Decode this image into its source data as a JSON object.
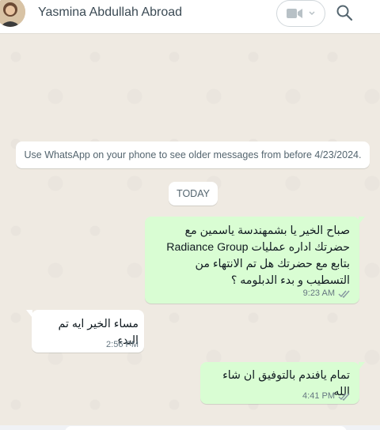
{
  "header": {
    "contact_name": "Yasmina Abdullah Abroad",
    "video_icon": "video-camera-icon",
    "dropdown_icon": "chevron-down-icon",
    "search_icon": "search-icon"
  },
  "chat": {
    "system_notice": "Use WhatsApp on your phone to see older messages from before 4/23/2024.",
    "date_label": "TODAY",
    "messages": [
      {
        "direction": "outgoing",
        "text": "صباح الخير يا بشمهندسة ياسمين مع\nحضرتك اداره عمليات Radiance Group\nبتابع مع حضرتك هل تم الانتهاء من\nالتسطيب و بدء الدبلومه ؟",
        "time": "9:23 AM",
        "status": "read"
      },
      {
        "direction": "incoming",
        "text": "مساء الخير ايه تم البدء",
        "time": "2:56 PM"
      },
      {
        "direction": "outgoing",
        "text": "تمام يافندم بالتوفيق ان شاء الله",
        "time": "4:41 PM",
        "status": "read"
      }
    ]
  },
  "colors": {
    "chat_background": "#efeae2",
    "outgoing_bubble": "#d9fdd3",
    "incoming_bubble": "#ffffff",
    "read_ticks": "#8696a0"
  }
}
